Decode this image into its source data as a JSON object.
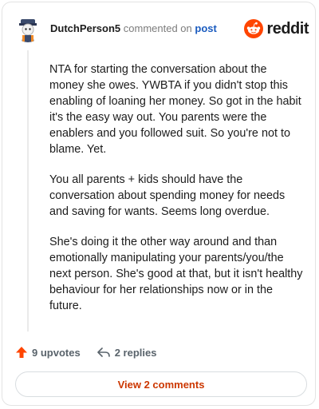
{
  "header": {
    "author": "DutchPerson5",
    "action_text": "commented on",
    "post_link": "post",
    "brand": "reddit"
  },
  "comment": {
    "paragraphs": [
      "NTA for starting the conversation about the money she owes. YWBTA if you didn't stop this enabling of loaning her money. So got in the habit it's the easy way out. You parents were the enablers and you followed suit. So you're not to blame. Yet.",
      "You all parents + kids should have the conversation about spending money for needs and saving for wants. Seems long overdue.",
      "She's doing it the other way around and than emotionally manipulating your parents/you/the next person. She's good at that, but it isn't healthy behaviour for her relationships now or in the future."
    ]
  },
  "actions": {
    "upvotes": "9 upvotes",
    "replies": "2 replies"
  },
  "footer": {
    "view_comments": "View 2 comments"
  },
  "colors": {
    "upvote": "#ff4500",
    "link": "#1a5bbf",
    "view_button_text": "#cc3700"
  },
  "icons": [
    "avatar",
    "reddit-snoo-icon",
    "upvote-arrow-icon",
    "reply-arrow-icon"
  ]
}
